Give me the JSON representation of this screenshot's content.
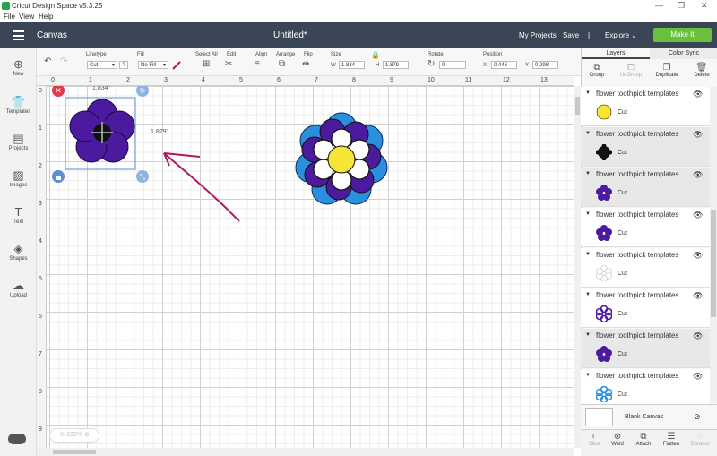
{
  "window": {
    "title": "Cricut Design Space  v5.3.25",
    "menu": [
      "File",
      "View",
      "Help"
    ]
  },
  "header": {
    "canvas_title": "Canvas",
    "doc_title": "Untitled*",
    "my_projects": "My Projects",
    "save": "Save",
    "separator": "|",
    "explore": "Explore",
    "make_it": "Make It"
  },
  "toolbar": {
    "linetype_label": "Linetype",
    "linetype_value": "Cut",
    "fill_label": "Fill",
    "fill_value": "No Fill",
    "select_all": "Select All",
    "edit": "Edit",
    "align": "Align",
    "arrange": "Arrange",
    "flip": "Flip",
    "size_label": "Size",
    "w_label": "W",
    "w_value": "1.834",
    "h_label": "H",
    "h_value": "1.879",
    "rotate_label": "Rotate",
    "rotate_value": "0",
    "position_label": "Position",
    "x_label": "X",
    "x_value": "0.446",
    "y_label": "Y",
    "y_value": "0.298"
  },
  "sidebar": {
    "items": [
      {
        "label": "New",
        "icon": "plus-circle-icon"
      },
      {
        "label": "Templates",
        "icon": "shirt-icon"
      },
      {
        "label": "Projects",
        "icon": "book-icon"
      },
      {
        "label": "Images",
        "icon": "image-icon"
      },
      {
        "label": "Text",
        "icon": "text-icon"
      },
      {
        "label": "Shapes",
        "icon": "shapes-icon"
      },
      {
        "label": "Upload",
        "icon": "upload-cloud-icon"
      }
    ]
  },
  "canvas": {
    "ruler_top": [
      "0",
      "1",
      "2",
      "3",
      "4",
      "5",
      "6",
      "7",
      "8",
      "9",
      "10",
      "11",
      "12",
      "13"
    ],
    "ruler_left": [
      "0",
      "1",
      "2",
      "3",
      "4",
      "5",
      "6",
      "7",
      "8",
      "9"
    ],
    "width_readout": "1.834\"",
    "height_readout": "1.879\"",
    "zoom": "100%"
  },
  "panel": {
    "tab_layers": "Layers",
    "tab_color_sync": "Color Sync",
    "tools": [
      "Group",
      "UnGroup",
      "Duplicate",
      "Delete"
    ],
    "layers": [
      {
        "name": "flower toothpick templates",
        "op": "Cut",
        "thumb": "yellow-circle",
        "color": "#f5e633"
      },
      {
        "name": "flower toothpick templates",
        "op": "Cut",
        "thumb": "black-burst",
        "color": "#111111"
      },
      {
        "name": "flower toothpick templates",
        "op": "Cut",
        "thumb": "purple-flower",
        "color": "#4b1a9e"
      },
      {
        "name": "flower toothpick templates",
        "op": "Cut",
        "thumb": "purple-flower",
        "color": "#4b1a9e"
      },
      {
        "name": "flower toothpick templates",
        "op": "Cut",
        "thumb": "white-flower",
        "color": "#ffffff"
      },
      {
        "name": "flower toothpick templates",
        "op": "Cut",
        "thumb": "purple-outline-flower",
        "color": "#4b1a9e"
      },
      {
        "name": "flower toothpick templates",
        "op": "Cut",
        "thumb": "purple-flower",
        "color": "#4b1a9e"
      },
      {
        "name": "flower toothpick templates",
        "op": "Cut",
        "thumb": "blue-flower",
        "color": "#2b8fe0"
      }
    ],
    "blank_canvas": "Blank Canvas",
    "bottom_tools": [
      "Slice",
      "Weld",
      "Attach",
      "Flatten",
      "Contour"
    ]
  },
  "colors": {
    "header_bg": "#3a4655",
    "make_it": "#6abf3d",
    "purple": "#4b1a9e",
    "blue": "#2b8fe0",
    "yellow": "#f5e633",
    "arrow": "#b0185e"
  }
}
